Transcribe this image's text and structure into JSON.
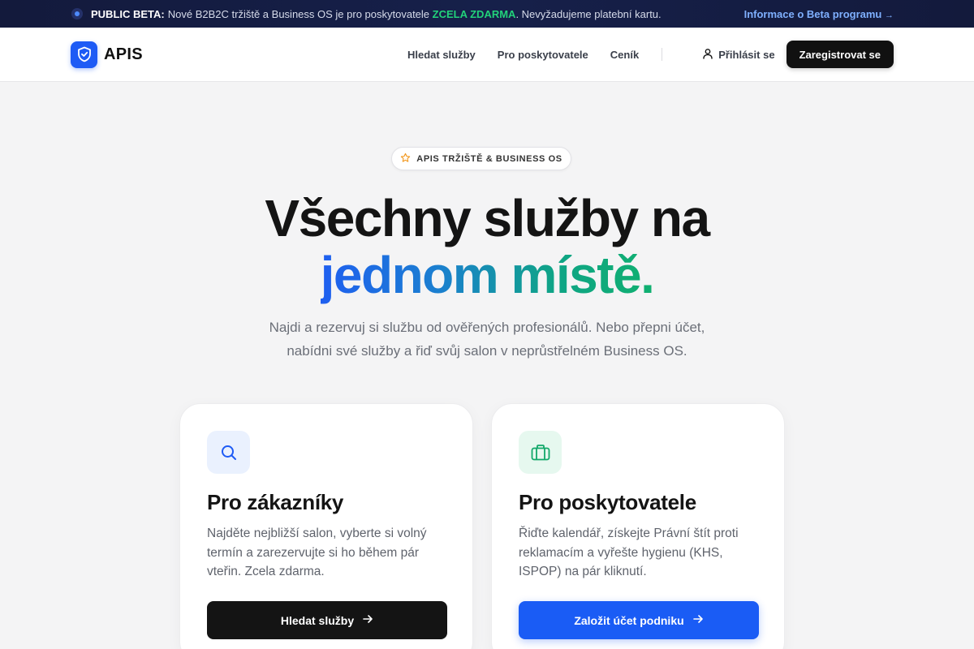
{
  "banner": {
    "label": "PUBLIC BETA:",
    "text_before": "Nové B2B2C tržiště a Business OS je pro poskytovatele",
    "highlight": "ZCELA ZDARMA",
    "text_after": ". Nevyžadujeme platební kartu.",
    "link": "Informace o Beta programu",
    "link_arrow": "→"
  },
  "header": {
    "logo_text": "APIS",
    "nav": [
      "Hledat služby",
      "Pro poskytovatele",
      "Ceník"
    ],
    "login": "Přihlásit se",
    "register": "Zaregistrovat se"
  },
  "hero": {
    "badge": "APIS TRŽIŠTĚ & BUSINESS OS",
    "title_line1": "Všechny služby na",
    "title_accent": "jednom místě.",
    "subtitle_line1": "Najdi a rezervuj si službu od ověřených profesionálů. Nebo přepni účet,",
    "subtitle_line2": "nabídni své služby a řiď svůj salon v neprůstřelném Business OS."
  },
  "cards": [
    {
      "icon": "search-icon",
      "title": "Pro zákazníky",
      "description": "Najděte nejbližší salon, vyberte si volný termín a zarezervujte si ho během pár vteřin. Zcela zdarma.",
      "button": "Hledat služby"
    },
    {
      "icon": "briefcase-icon",
      "title": "Pro poskytovatele",
      "description": "Řiďte kalendář, získejte Právní štít proti reklamacím a vyřešte hygienu (KHS, ISPOP) na pár kliknutí.",
      "button": "Založit účet podniku"
    }
  ],
  "colors": {
    "brand_blue": "#1e5bf5",
    "banner_bg": "#16204a",
    "banner_highlight": "#22d27a",
    "accent_green": "#10b070"
  }
}
